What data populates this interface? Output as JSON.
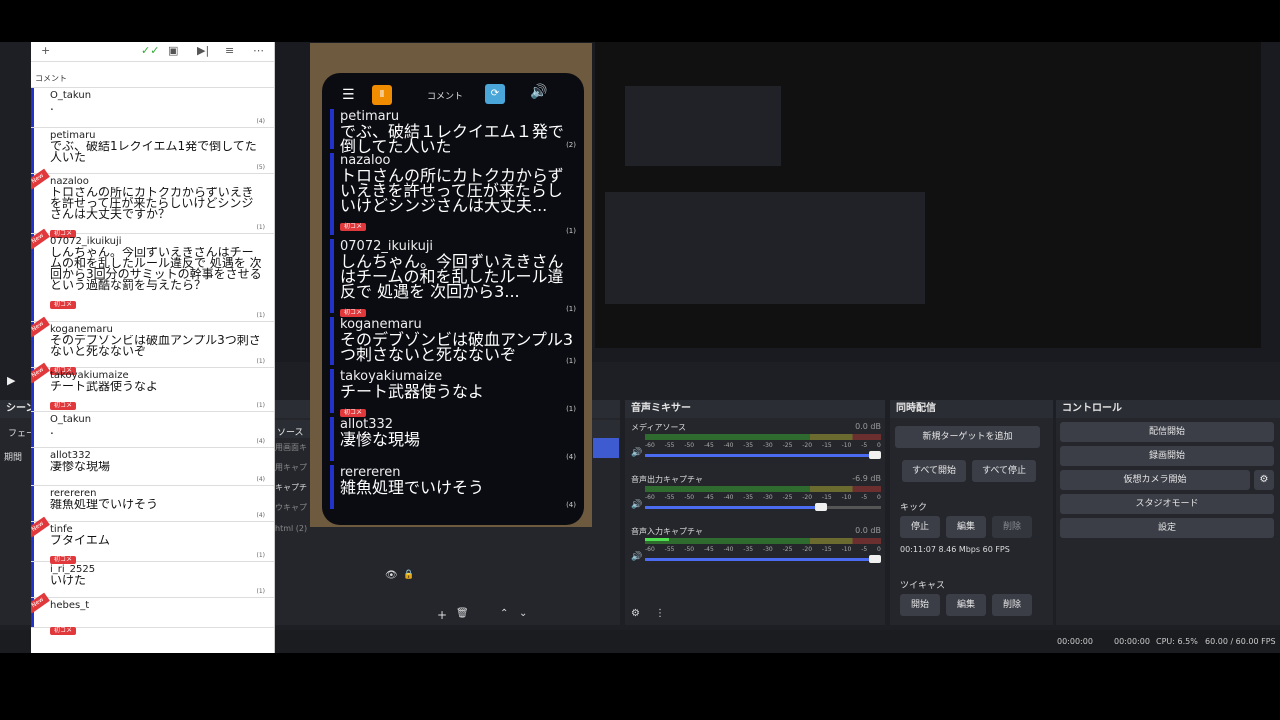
{
  "comment_panel": {
    "title": "コメント",
    "toolbar_icons": [
      "add-icon",
      "check-icon",
      "columns-icon",
      "next-icon",
      "list-icon",
      "more-icon"
    ],
    "items": [
      {
        "user": "O_takun",
        "text": ".",
        "num": "(4)",
        "new": false,
        "badge": ""
      },
      {
        "user": "petimaru",
        "text": "でぶ、破結1レクイエム1発で倒してた人いた",
        "num": "(5)",
        "new": false,
        "badge": ""
      },
      {
        "user": "nazaloo",
        "text": "トロさんの所にカトクカからずいえきを許せって圧が来たらしいけどシンジさんは大丈夫ですか？",
        "num": "(1)",
        "new": true,
        "badge": "初コメ"
      },
      {
        "user": "07072_ikuikuji",
        "text": "しんちゃん。今回ずいえきさんはチームの和を乱したルール違反で 処遇を 次回から3回分のサミットの幹事をさせるという過酷な罰を与えたら？",
        "num": "(1)",
        "new": true,
        "badge": "初コメ"
      },
      {
        "user": "koganemaru",
        "text": "そのデブゾンビは破血アンプル3つ刺さないと死なないぞ",
        "num": "(1)",
        "new": true,
        "badge": "初コメ"
      },
      {
        "user": "takoyakiumaize",
        "text": "チート武器使うなよ",
        "num": "(1)",
        "new": true,
        "badge": "初コメ"
      },
      {
        "user": "O_takun",
        "text": ".",
        "num": "(4)",
        "new": false,
        "badge": ""
      },
      {
        "user": "allot332",
        "text": "凄惨な現場",
        "num": "(4)",
        "new": false,
        "badge": ""
      },
      {
        "user": "rerereren",
        "text": "雑魚処理でいけそう",
        "num": "(4)",
        "new": false,
        "badge": ""
      },
      {
        "user": "tinfe",
        "text": "ブタイエム",
        "num": "(1)",
        "new": true,
        "badge": "初コメ"
      },
      {
        "user": "i_ri_2525",
        "text": "いけた",
        "num": "(1)",
        "new": false,
        "badge": ""
      },
      {
        "user": "hebes_t",
        "text": ".",
        "num": "",
        "new": true,
        "badge": "初コメ"
      }
    ]
  },
  "phone": {
    "app_label": "コメント",
    "items": [
      {
        "user": "petimaru",
        "text": "でぶ、破結１レクイエム１発で倒してた人いた",
        "num": "(2)",
        "new": false
      },
      {
        "user": "nazaloo",
        "text": "トロさんの所にカトクカからずいえきを許せって圧が来たらしいけどシンジさんは大丈夫...",
        "num": "(1)",
        "new": true,
        "badge": "初コメ"
      },
      {
        "user": "07072_ikuikuji",
        "text": "しんちゃん。今回ずいえきさんはチームの和を乱したルール違反で 処遇を 次回から3...",
        "num": "(1)",
        "new": true,
        "badge": "初コメ"
      },
      {
        "user": "koganemaru",
        "text": "そのデブゾンビは破血アンプル3つ刺さないと死なないぞ",
        "num": "(1)",
        "new": true,
        "badge": "初コメ"
      },
      {
        "user": "takoyakiumaize",
        "text": "チート武器使うなよ",
        "num": "(1)",
        "new": true,
        "badge": "初コメ"
      },
      {
        "user": "allot332",
        "text": "凄惨な現場",
        "num": "(4)",
        "new": false
      },
      {
        "user": "rerereren",
        "text": "雑魚処理でいけそう",
        "num": "(4)",
        "new": false
      }
    ]
  },
  "scenes": {
    "header": "シーン",
    "tab_fade": "フェー",
    "duration": "期間"
  },
  "sources": {
    "items": [
      "ソース",
      "用画面キ",
      "用キャプ",
      "キャプチ",
      "ウキャプ",
      "html (2)"
    ]
  },
  "mixer": {
    "title": "音声ミキサー",
    "tracks": [
      {
        "name": "メディアソース",
        "db": "0.0 dB",
        "level": 0.0,
        "volume": 1.0
      },
      {
        "name": "音声出力キャプチャ",
        "db": "-6.9 dB",
        "level": 0.0,
        "volume": 0.72
      },
      {
        "name": "音声入力キャプチャ",
        "db": "0.0 dB",
        "level": 0.1,
        "volume": 1.0
      }
    ],
    "scale": [
      "-60",
      "-55",
      "-50",
      "-45",
      "-40",
      "-35",
      "-30",
      "-25",
      "-20",
      "-15",
      "-10",
      "-5",
      "0"
    ]
  },
  "multistream": {
    "title": "同時配信",
    "add_target": "新規ターゲットを追加",
    "start_all": "すべて開始",
    "stop_all": "すべて停止",
    "kick": {
      "name": "キック",
      "stop": "停止",
      "edit": "編集",
      "delete": "削除",
      "stats": "00:11:07  8.46 Mbps  60 FPS"
    },
    "twitcas": {
      "name": "ツイキャス",
      "start": "開始",
      "edit": "編集",
      "delete": "削除"
    }
  },
  "controls": {
    "title": "コントロール",
    "buttons": [
      "配信開始",
      "録画開始",
      "仮想カメラ開始",
      "スタジオモード",
      "設定"
    ]
  },
  "status_bar": {
    "stream_time": "00:00:00",
    "rec_time": "00:00:00",
    "cpu": "CPU: 6.5%",
    "fps": "60.00 / 60.00 FPS"
  }
}
